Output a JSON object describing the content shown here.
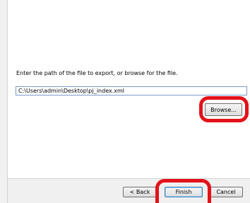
{
  "dialog": {
    "instruction": "Enter the path of the file to export, or browse for the file.",
    "path_value": "C:\\Users\\admin\\Desktop\\pj_index.xml",
    "browse_label": "Browse...",
    "back_label": "< Back",
    "finish_label": "Finish",
    "cancel_label": "Cancel"
  },
  "colors": {
    "highlight": "#e3121a",
    "input_border": "#7a9ac7",
    "default_button_border": "#3c7fb1"
  }
}
